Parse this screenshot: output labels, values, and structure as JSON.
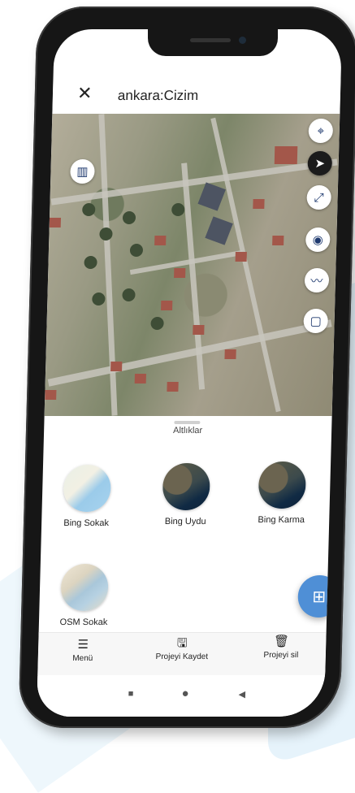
{
  "header": {
    "title": "ankara:Cizim"
  },
  "sheet": {
    "title": "Altlıklar"
  },
  "layers": [
    {
      "label": "Bing Sokak",
      "thumb": "street"
    },
    {
      "label": "Bing Uydu",
      "thumb": "satellite"
    },
    {
      "label": "Bing Karma",
      "thumb": "satellite"
    },
    {
      "label": "OSM Sokak",
      "thumb": "street"
    }
  ],
  "bottom_nav": {
    "menu": "Menü",
    "save": "Projeyi Kaydet",
    "delete": "Projeyi sil"
  },
  "icons": {
    "close": "close-icon",
    "locate": "crosshair-icon",
    "basemap": "map-icon",
    "compass": "compass-icon",
    "fullscreen": "fullscreen-icon",
    "point": "point-icon",
    "line": "polyline-icon",
    "polygon": "polygon-icon",
    "fab": "add-photo-icon"
  },
  "colors": {
    "accent": "#4f8fd6",
    "icon": "#1f3a6f"
  }
}
